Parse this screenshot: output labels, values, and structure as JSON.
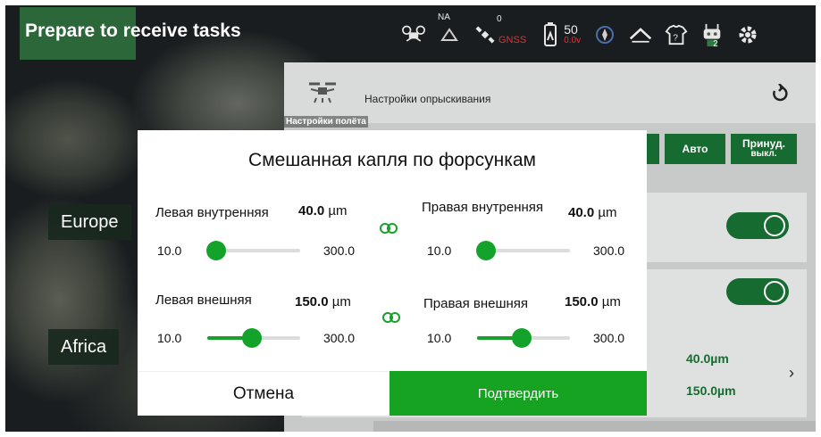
{
  "header": {
    "task_status": "Prepare to receive tasks",
    "status_icons": {
      "rtk_label": "NA",
      "gnss_count": "0",
      "gnss_label": "GNSS",
      "battery_percent": "50",
      "battery_voltage": "0.0v",
      "remote_badge": "2"
    }
  },
  "map": {
    "labels": [
      "Europe",
      "Africa"
    ]
  },
  "panel": {
    "title": "Настройки опрыскивания",
    "tab": "Настройки полёта",
    "buttons": {
      "auto": "Авто",
      "force_off_line1": "Принуд.",
      "force_off_line2": "выкл."
    },
    "summary": {
      "inner_value": "40.0µm",
      "outer_value": "150.0µm"
    },
    "toggles": [
      true,
      true
    ]
  },
  "dialog": {
    "title": "Смешанная капля по форсункам",
    "unit": "µm",
    "sliders": {
      "left_inner": {
        "label": "Левая внутренняя",
        "value": "40.0",
        "min": "10.0",
        "max": "300.0",
        "fraction": 0.1
      },
      "right_inner": {
        "label": "Правая внутренняя",
        "value": "40.0",
        "min": "10.0",
        "max": "300.0",
        "fraction": 0.1
      },
      "left_outer": {
        "label": "Левая внешняя",
        "value": "150.0",
        "min": "10.0",
        "max": "300.0",
        "fraction": 0.48
      },
      "right_outer": {
        "label": "Правая внешняя",
        "value": "150.0",
        "min": "10.0",
        "max": "300.0",
        "fraction": 0.48
      }
    },
    "cancel_label": "Отмена",
    "confirm_label": "Подтвердить"
  },
  "colors": {
    "accent": "#16a322",
    "brand_dark": "#166b30",
    "battery_warning": "#d33333"
  }
}
